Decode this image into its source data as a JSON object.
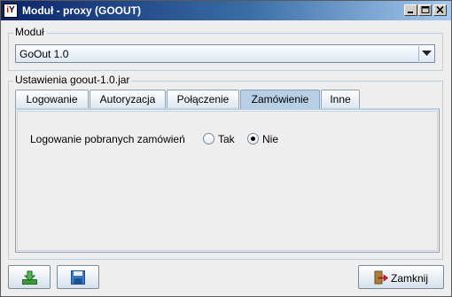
{
  "window": {
    "title": "Moduł - proxy (GOOUT)",
    "app_icon_letters": "iY"
  },
  "module_group": {
    "label": "Moduł",
    "selected": "GoOut 1.0"
  },
  "settings_group": {
    "label": "Ustawienia goout-1.0.jar"
  },
  "tabs": [
    {
      "label": "Logowanie",
      "active": false
    },
    {
      "label": "Autoryzacja",
      "active": false
    },
    {
      "label": "Połączenie",
      "active": false
    },
    {
      "label": "Zamówienie",
      "active": true
    },
    {
      "label": "Inne",
      "active": false
    }
  ],
  "order_tab": {
    "setting_label": "Logowanie pobranych zamówień",
    "options": [
      {
        "label": "Tak",
        "checked": false
      },
      {
        "label": "Nie",
        "checked": true
      }
    ]
  },
  "buttons": {
    "close_label": "Zamknij"
  },
  "icons": {
    "import": "download-green-icon",
    "save": "floppy-disk-icon",
    "close": "exit-door-icon"
  },
  "colors": {
    "title_gradient_start": "#0a246a",
    "title_gradient_end": "#a6caf0",
    "active_tab": "#b8cfe5",
    "background": "#eeeeee"
  }
}
